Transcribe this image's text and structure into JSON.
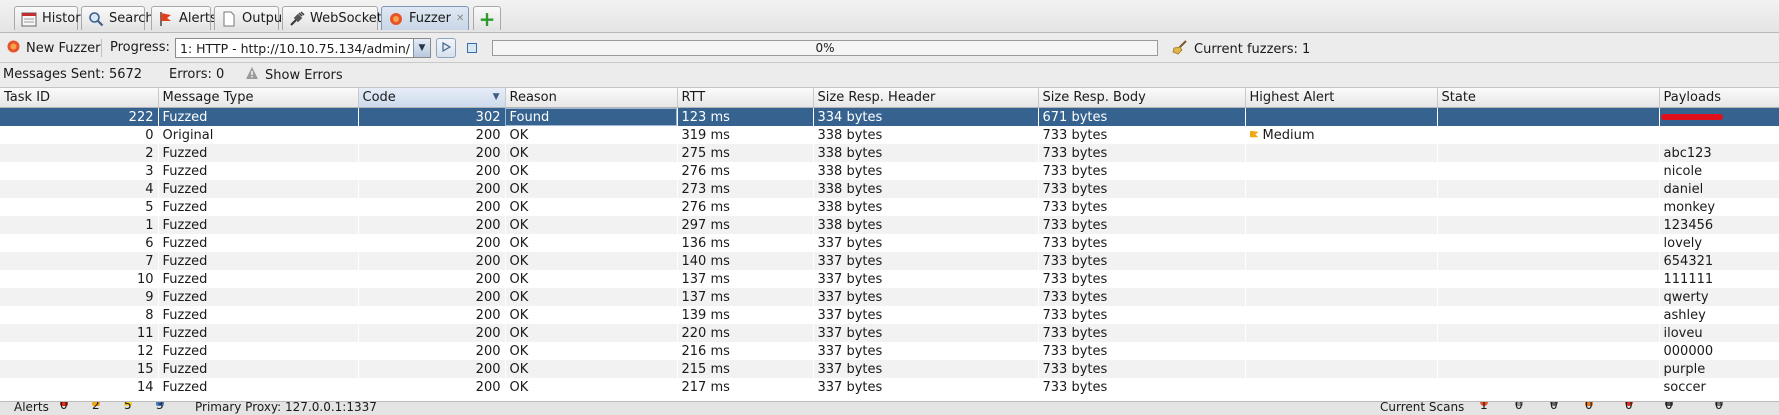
{
  "tabs": [
    {
      "label": "History"
    },
    {
      "label": "Search"
    },
    {
      "label": "Alerts"
    },
    {
      "label": "Output"
    },
    {
      "label": "WebSockets"
    },
    {
      "label": "Fuzzer"
    }
  ],
  "toolbar": {
    "new_fuzzer": "New Fuzzer",
    "progress_label": "Progress:",
    "progress_select": "1: HTTP - http://10.10.75.134/admin/",
    "progress_text": "0%",
    "progress_value": 0,
    "current_fuzzers": "Current fuzzers: 1"
  },
  "status": {
    "messages_sent": "Messages Sent: 5672",
    "errors": "Errors: 0",
    "show_errors": "Show Errors"
  },
  "table": {
    "columns": [
      "Task ID",
      "Message Type",
      "Code",
      "Reason",
      "RTT",
      "Size Resp. Header",
      "Size Resp. Body",
      "Highest Alert",
      "State",
      "Payloads"
    ],
    "sorted_column": "Code",
    "rows": [
      {
        "id": "222",
        "type": "Fuzzed",
        "code": "302",
        "reason": "Found",
        "rtt": "123 ms",
        "hdr": "334 bytes",
        "body": "671 bytes",
        "alert": "",
        "state": "",
        "payload": ""
      },
      {
        "id": "0",
        "type": "Original",
        "code": "200",
        "reason": "OK",
        "rtt": "319 ms",
        "hdr": "338 bytes",
        "body": "733 bytes",
        "alert": "Medium",
        "state": "",
        "payload": ""
      },
      {
        "id": "2",
        "type": "Fuzzed",
        "code": "200",
        "reason": "OK",
        "rtt": "275 ms",
        "hdr": "338 bytes",
        "body": "733 bytes",
        "alert": "",
        "state": "",
        "payload": "abc123"
      },
      {
        "id": "3",
        "type": "Fuzzed",
        "code": "200",
        "reason": "OK",
        "rtt": "276 ms",
        "hdr": "338 bytes",
        "body": "733 bytes",
        "alert": "",
        "state": "",
        "payload": "nicole"
      },
      {
        "id": "4",
        "type": "Fuzzed",
        "code": "200",
        "reason": "OK",
        "rtt": "273 ms",
        "hdr": "338 bytes",
        "body": "733 bytes",
        "alert": "",
        "state": "",
        "payload": "daniel"
      },
      {
        "id": "5",
        "type": "Fuzzed",
        "code": "200",
        "reason": "OK",
        "rtt": "276 ms",
        "hdr": "338 bytes",
        "body": "733 bytes",
        "alert": "",
        "state": "",
        "payload": "monkey"
      },
      {
        "id": "1",
        "type": "Fuzzed",
        "code": "200",
        "reason": "OK",
        "rtt": "297 ms",
        "hdr": "338 bytes",
        "body": "733 bytes",
        "alert": "",
        "state": "",
        "payload": "123456"
      },
      {
        "id": "6",
        "type": "Fuzzed",
        "code": "200",
        "reason": "OK",
        "rtt": "136 ms",
        "hdr": "337 bytes",
        "body": "733 bytes",
        "alert": "",
        "state": "",
        "payload": "lovely"
      },
      {
        "id": "7",
        "type": "Fuzzed",
        "code": "200",
        "reason": "OK",
        "rtt": "140 ms",
        "hdr": "337 bytes",
        "body": "733 bytes",
        "alert": "",
        "state": "",
        "payload": "654321"
      },
      {
        "id": "10",
        "type": "Fuzzed",
        "code": "200",
        "reason": "OK",
        "rtt": "137 ms",
        "hdr": "337 bytes",
        "body": "733 bytes",
        "alert": "",
        "state": "",
        "payload": "111111"
      },
      {
        "id": "9",
        "type": "Fuzzed",
        "code": "200",
        "reason": "OK",
        "rtt": "137 ms",
        "hdr": "337 bytes",
        "body": "733 bytes",
        "alert": "",
        "state": "",
        "payload": "qwerty"
      },
      {
        "id": "8",
        "type": "Fuzzed",
        "code": "200",
        "reason": "OK",
        "rtt": "139 ms",
        "hdr": "337 bytes",
        "body": "733 bytes",
        "alert": "",
        "state": "",
        "payload": "ashley"
      },
      {
        "id": "11",
        "type": "Fuzzed",
        "code": "200",
        "reason": "OK",
        "rtt": "220 ms",
        "hdr": "337 bytes",
        "body": "733 bytes",
        "alert": "",
        "state": "",
        "payload": "iloveu"
      },
      {
        "id": "12",
        "type": "Fuzzed",
        "code": "200",
        "reason": "OK",
        "rtt": "216 ms",
        "hdr": "337 bytes",
        "body": "733 bytes",
        "alert": "",
        "state": "",
        "payload": "000000"
      },
      {
        "id": "15",
        "type": "Fuzzed",
        "code": "200",
        "reason": "OK",
        "rtt": "215 ms",
        "hdr": "337 bytes",
        "body": "733 bytes",
        "alert": "",
        "state": "",
        "payload": "purple"
      },
      {
        "id": "14",
        "type": "Fuzzed",
        "code": "200",
        "reason": "OK",
        "rtt": "217 ms",
        "hdr": "337 bytes",
        "body": "733 bytes",
        "alert": "",
        "state": "",
        "payload": "soccer"
      }
    ]
  },
  "footer": {
    "alerts": "Alerts",
    "counts": [
      "0",
      "2",
      "5",
      "3"
    ],
    "proxy": "Primary Proxy: 127.0.0.1:1337",
    "current_scans": "Current Scans",
    "scan_counts": [
      "1",
      "0",
      "0",
      "0",
      "0",
      "0",
      "0"
    ]
  },
  "colors": {
    "selected_row": "#36628f",
    "progress_fill": "#6f94c4",
    "alert_medium": "#f0a818",
    "redaction": "#e0101a"
  }
}
